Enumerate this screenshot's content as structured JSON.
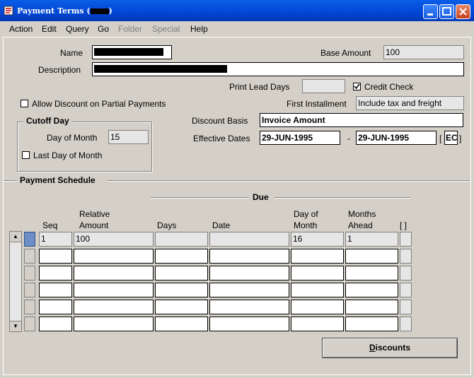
{
  "window": {
    "title": "Payment Terms (",
    "title_end": ")"
  },
  "menu": [
    "Action",
    "Edit",
    "Query",
    "Go",
    "Folder",
    "Special",
    "Help"
  ],
  "header": {
    "name_label": "Name",
    "base_amount_label": "Base Amount",
    "base_amount_value": "100",
    "description_label": "Description",
    "print_lead_days_label": "Print Lead Days",
    "print_lead_days_value": "",
    "credit_check_label": "Credit Check",
    "credit_check_checked": true,
    "allow_discount_label": "Allow Discount on Partial Payments",
    "allow_discount_checked": false,
    "first_installment_label": "First Installment",
    "first_installment_value": "Include tax and freight",
    "discount_basis_label": "Discount Basis",
    "discount_basis_value": "Invoice Amount",
    "effective_dates_label": "Effective Dates",
    "effective_from": "29-JUN-1995",
    "date_separator": "-",
    "effective_to": "29-JUN-1995",
    "dff_open": "[",
    "dff_value": "EC",
    "dff_close": "]"
  },
  "cutoff": {
    "title": "Cutoff Day",
    "day_of_month_label": "Day of Month",
    "day_of_month_value": "15",
    "last_day_label": "Last Day of Month",
    "last_day_checked": false
  },
  "schedule": {
    "title": "Payment Schedule",
    "due_label": "Due",
    "headers": {
      "seq": "Seq",
      "relative_amount_1": "Relative",
      "relative_amount_2": "Amount",
      "days": "Days",
      "date": "Date",
      "day_of_month_1": "Day of",
      "day_of_month_2": "Month",
      "months_ahead_1": "Months",
      "months_ahead_2": "Ahead",
      "dff": "[ ]"
    },
    "rows": [
      {
        "seq": "1",
        "relative_amount": "100",
        "days": "",
        "date": "",
        "day_of_month": "16",
        "months_ahead": "1"
      },
      {
        "seq": "",
        "relative_amount": "",
        "days": "",
        "date": "",
        "day_of_month": "",
        "months_ahead": ""
      },
      {
        "seq": "",
        "relative_amount": "",
        "days": "",
        "date": "",
        "day_of_month": "",
        "months_ahead": ""
      },
      {
        "seq": "",
        "relative_amount": "",
        "days": "",
        "date": "",
        "day_of_month": "",
        "months_ahead": ""
      },
      {
        "seq": "",
        "relative_amount": "",
        "days": "",
        "date": "",
        "day_of_month": "",
        "months_ahead": ""
      },
      {
        "seq": "",
        "relative_amount": "",
        "days": "",
        "date": "",
        "day_of_month": "",
        "months_ahead": ""
      }
    ]
  },
  "buttons": {
    "discounts": "Discounts"
  }
}
